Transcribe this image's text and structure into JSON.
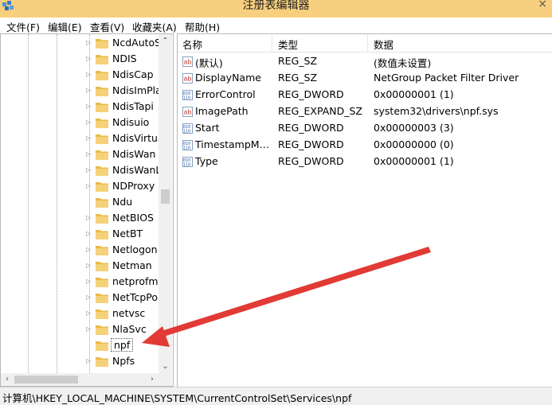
{
  "window": {
    "title": "注册表编辑器",
    "close_glyph": "×"
  },
  "menu": [
    "文件(F)",
    "编辑(E)",
    "查看(V)",
    "收藏夹(A)",
    "帮助(H)"
  ],
  "tree": {
    "nodes": [
      {
        "label": "NcdAutoS",
        "expander": "▷"
      },
      {
        "label": "NDIS",
        "expander": "▷"
      },
      {
        "label": "NdisCap",
        "expander": "▷"
      },
      {
        "label": "NdisImPla",
        "expander": "▷"
      },
      {
        "label": "NdisTapi",
        "expander": "▷"
      },
      {
        "label": "Ndisuio",
        "expander": "▷"
      },
      {
        "label": "NdisVirtua",
        "expander": "▷"
      },
      {
        "label": "NdisWan",
        "expander": "▷"
      },
      {
        "label": "NdisWanL",
        "expander": "▷"
      },
      {
        "label": "NDProxy",
        "expander": "▷"
      },
      {
        "label": "Ndu",
        "expander": ""
      },
      {
        "label": "NetBIOS",
        "expander": "▷"
      },
      {
        "label": "NetBT",
        "expander": "▷"
      },
      {
        "label": "Netlogon",
        "expander": "▷"
      },
      {
        "label": "Netman",
        "expander": "▷"
      },
      {
        "label": "netprofm",
        "expander": "▷"
      },
      {
        "label": "NetTcpPo",
        "expander": "▷"
      },
      {
        "label": "netvsc",
        "expander": "▷"
      },
      {
        "label": "NlaSvc",
        "expander": "▷"
      },
      {
        "label": "npf",
        "expander": "",
        "selected": true
      },
      {
        "label": "Npfs",
        "expander": "▷"
      }
    ]
  },
  "values_table": {
    "headers": [
      "名称",
      "类型",
      "数据"
    ],
    "rows": [
      {
        "name": "(默认)",
        "type": "REG_SZ",
        "data": "(数值未设置)",
        "icon": "string-value-icon"
      },
      {
        "name": "DisplayName",
        "type": "REG_SZ",
        "data": "NetGroup Packet Filter Driver",
        "icon": "string-value-icon"
      },
      {
        "name": "ErrorControl",
        "type": "REG_DWORD",
        "data": "0x00000001 (1)",
        "icon": "binary-value-icon"
      },
      {
        "name": "ImagePath",
        "type": "REG_EXPAND_SZ",
        "data": "system32\\drivers\\npf.sys",
        "icon": "string-value-icon"
      },
      {
        "name": "Start",
        "type": "REG_DWORD",
        "data": "0x00000003 (3)",
        "icon": "binary-value-icon"
      },
      {
        "name": "TimestampMode",
        "display_name": "TimestampMo...",
        "type": "REG_DWORD",
        "data": "0x00000000 (0)",
        "icon": "binary-value-icon"
      },
      {
        "name": "Type",
        "type": "REG_DWORD",
        "data": "0x00000001 (1)",
        "icon": "binary-value-icon"
      }
    ]
  },
  "status": {
    "path": "计算机\\HKEY_LOCAL_MACHINE\\SYSTEM\\CurrentControlSet\\Services\\npf"
  },
  "colors": {
    "titlebar": "#f8cf7e",
    "annotation_arrow": "#e23a35",
    "folder": "#e8bb4a"
  }
}
